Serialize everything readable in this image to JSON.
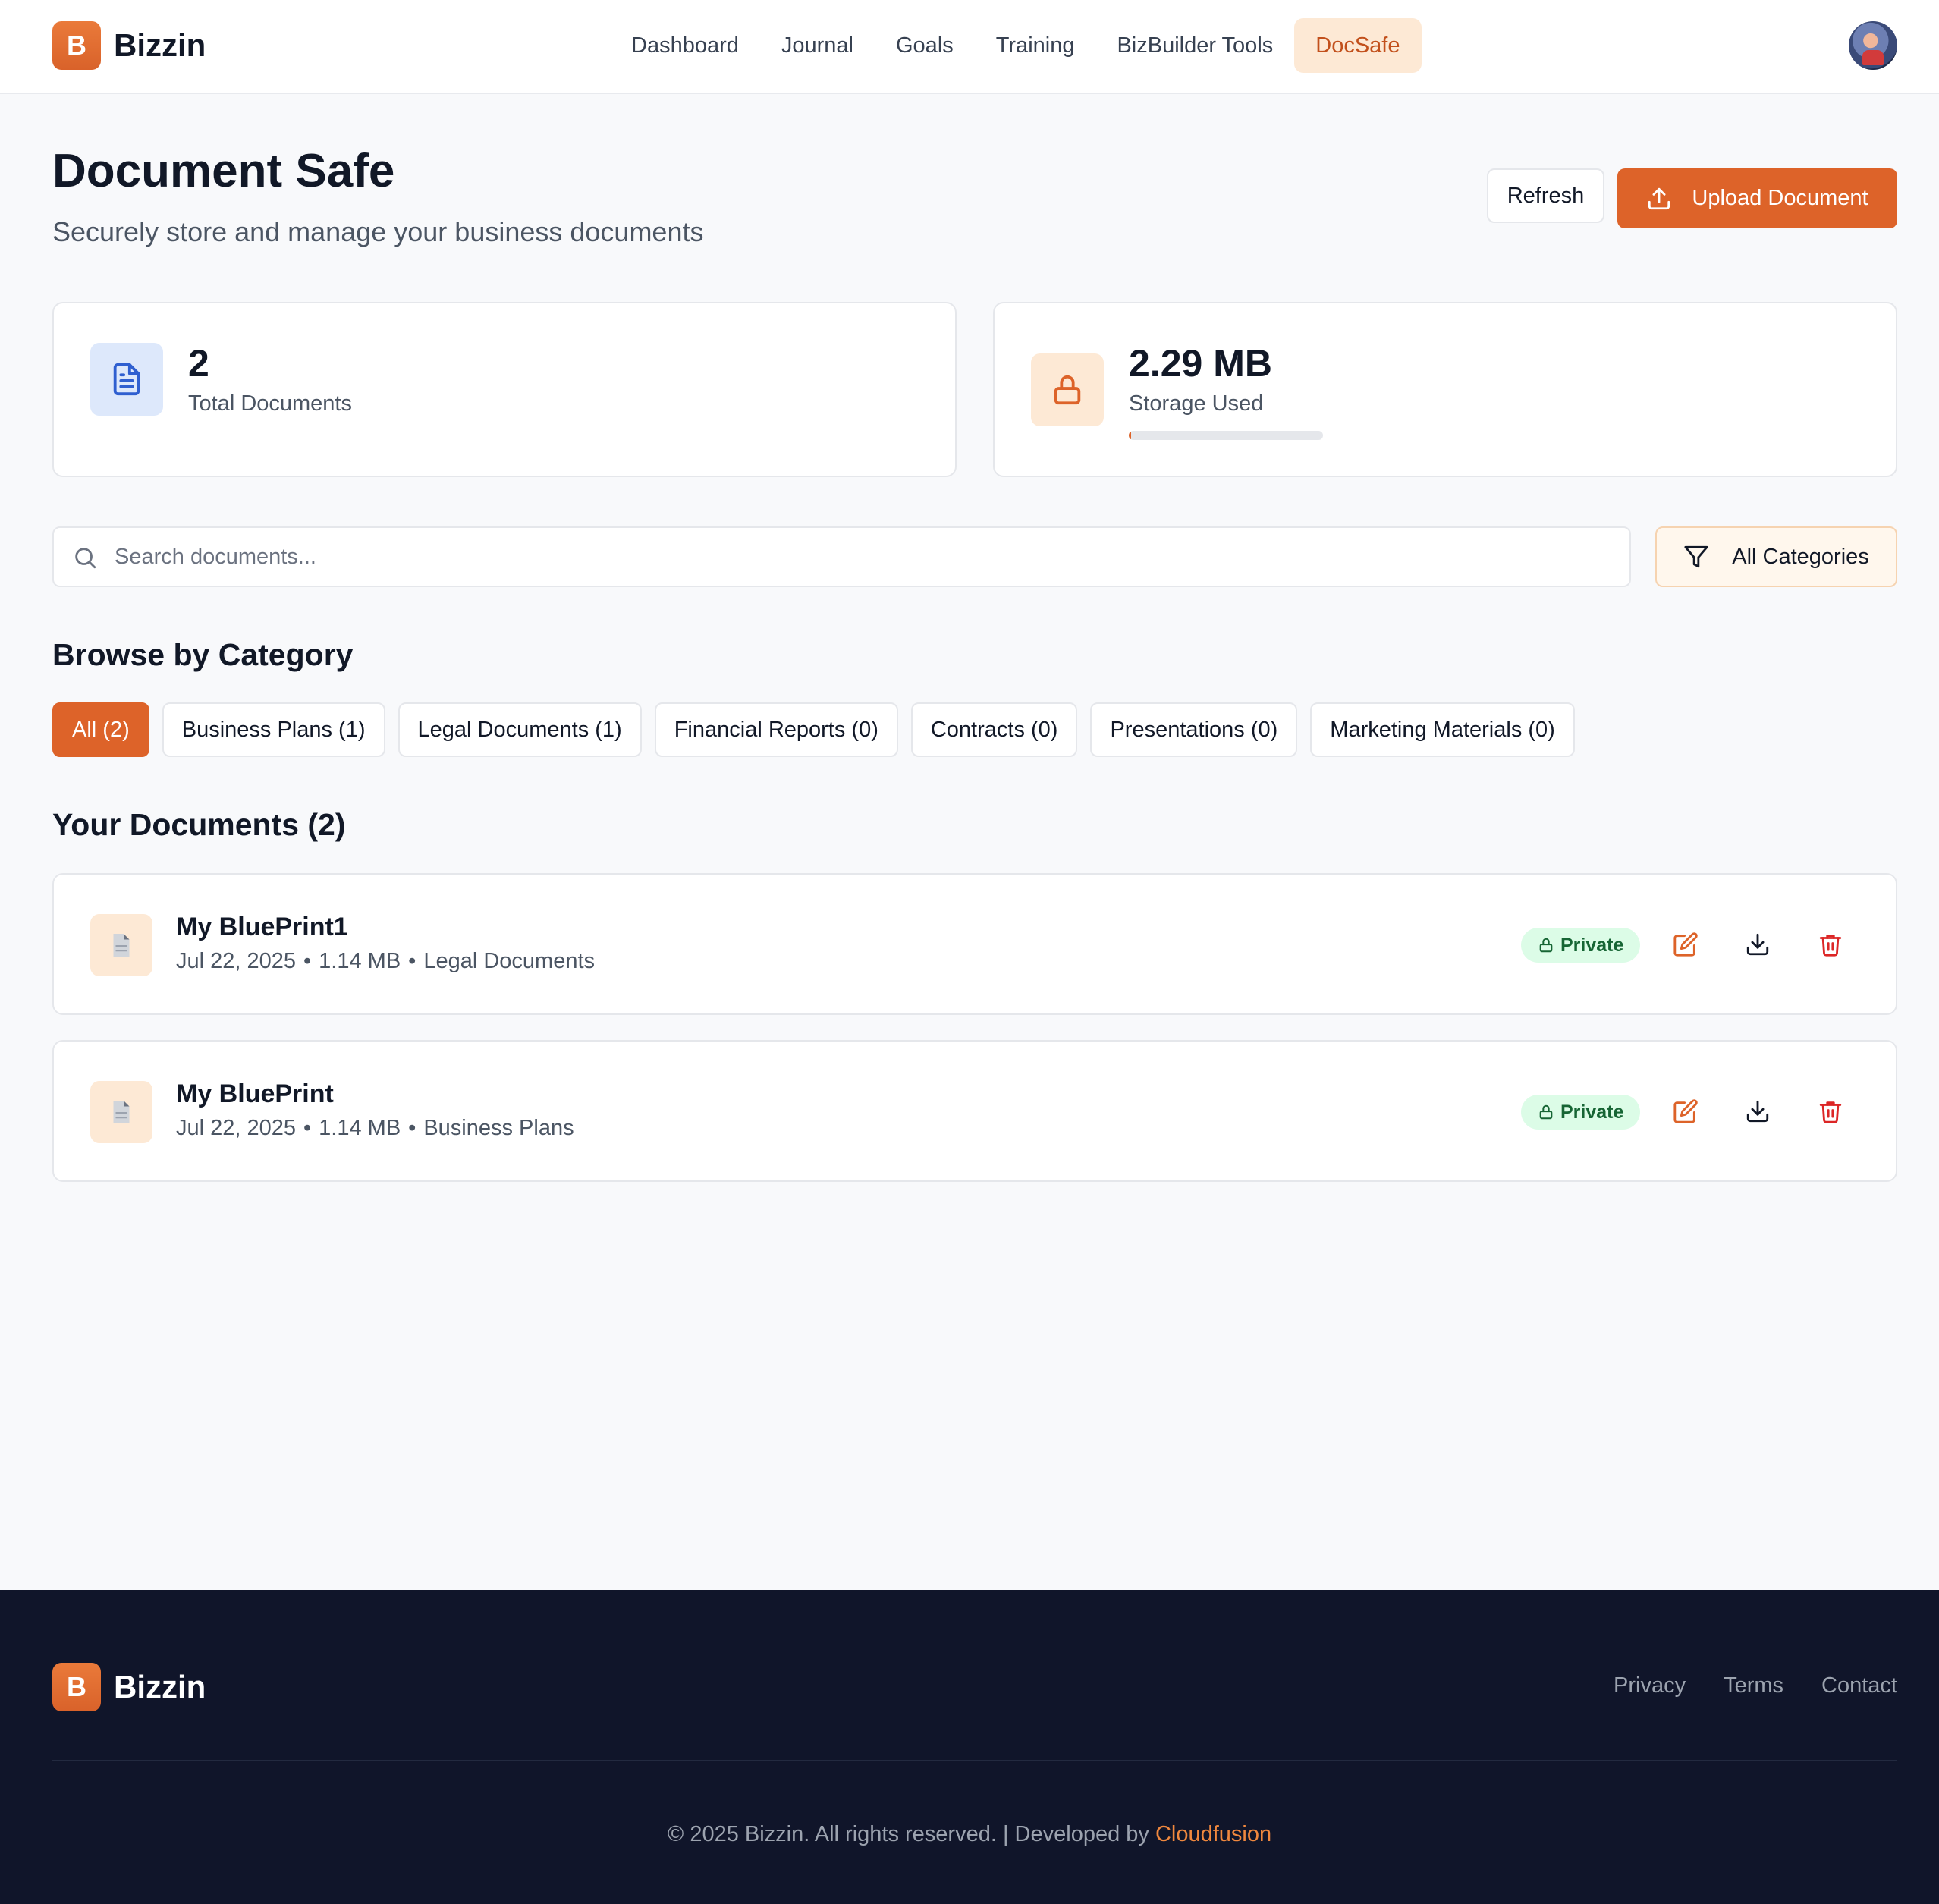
{
  "brand": {
    "logo_letter": "B",
    "name": "Bizzin"
  },
  "nav": {
    "items": [
      {
        "label": "Dashboard",
        "active": false
      },
      {
        "label": "Journal",
        "active": false
      },
      {
        "label": "Goals",
        "active": false
      },
      {
        "label": "Training",
        "active": false
      },
      {
        "label": "BizBuilder Tools",
        "active": false
      },
      {
        "label": "DocSafe",
        "active": true
      }
    ]
  },
  "header": {
    "title": "Document Safe",
    "subtitle": "Securely store and manage your business documents",
    "refresh_label": "Refresh",
    "upload_label": "Upload Document",
    "upload_icon": "upload-icon"
  },
  "stats": {
    "total": {
      "value": "2",
      "label": "Total Documents",
      "icon": "file-text-icon"
    },
    "storage": {
      "value": "2.29 MB",
      "label": "Storage Used",
      "icon": "lock-icon",
      "usage_fraction": 0.01
    }
  },
  "search": {
    "placeholder": "Search documents...",
    "value": "",
    "icon": "search-icon"
  },
  "category_filter": {
    "label": "All Categories",
    "icon": "filter-icon"
  },
  "categories": {
    "title": "Browse by Category",
    "items": [
      {
        "label": "All (2)",
        "active": true
      },
      {
        "label": "Business Plans (1)",
        "active": false
      },
      {
        "label": "Legal Documents (1)",
        "active": false
      },
      {
        "label": "Financial Reports (0)",
        "active": false
      },
      {
        "label": "Contracts (0)",
        "active": false
      },
      {
        "label": "Presentations (0)",
        "active": false
      },
      {
        "label": "Marketing Materials (0)",
        "active": false
      }
    ]
  },
  "documents": {
    "title": "Your Documents (2)",
    "items": [
      {
        "name": "My BluePrint1",
        "date": "Jul 22, 2025",
        "size": "1.14 MB",
        "category": "Legal Documents",
        "visibility": "Private"
      },
      {
        "name": "My BluePrint",
        "date": "Jul 22, 2025",
        "size": "1.14 MB",
        "category": "Business Plans",
        "visibility": "Private"
      }
    ],
    "separator": "•"
  },
  "footer": {
    "links": [
      "Privacy",
      "Terms",
      "Contact"
    ],
    "copyright": "© 2025 Bizzin. All rights reserved. | Developed by",
    "developer": "Cloudfusion"
  },
  "colors": {
    "accent": "#dd6329",
    "accent_soft": "#fde9d5",
    "footer_bg": "#10152a",
    "badge_bg": "#dcfce7",
    "danger": "#dc2626"
  }
}
